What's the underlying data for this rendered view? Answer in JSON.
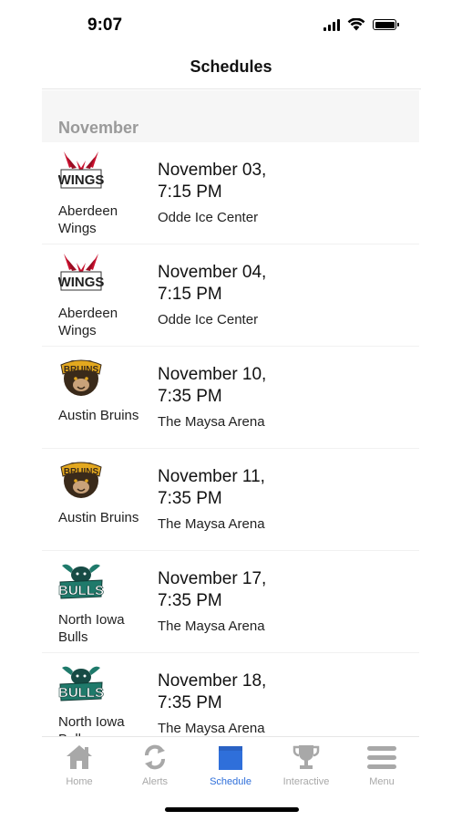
{
  "status_bar": {
    "time": "9:07"
  },
  "header": {
    "title": "Schedules"
  },
  "section": {
    "label": "November"
  },
  "games": [
    {
      "team": "Aberdeen Wings",
      "logo": "wings-logo-icon",
      "date_line1": "November 03,",
      "date_line2": "7:15 PM",
      "venue": "Odde Ice Center"
    },
    {
      "team": "Aberdeen Wings",
      "logo": "wings-logo-icon",
      "date_line1": "November 04,",
      "date_line2": "7:15 PM",
      "venue": "Odde Ice Center"
    },
    {
      "team": "Austin Bruins",
      "logo": "bruins-logo-icon",
      "date_line1": "November 10,",
      "date_line2": "7:35 PM",
      "venue": "The Maysa Arena"
    },
    {
      "team": "Austin Bruins",
      "logo": "bruins-logo-icon",
      "date_line1": "November 11,",
      "date_line2": "7:35 PM",
      "venue": "The Maysa Arena"
    },
    {
      "team": "North Iowa Bulls",
      "logo": "bulls-logo-icon",
      "date_line1": "November 17,",
      "date_line2": "7:35 PM",
      "venue": "The Maysa Arena"
    },
    {
      "team": "North Iowa Bulls",
      "logo": "bulls-logo-icon",
      "date_line1": "November 18,",
      "date_line2": "7:35 PM",
      "venue": "The Maysa Arena"
    }
  ],
  "tabs": [
    {
      "label": "Home",
      "icon": "home-icon",
      "active": false
    },
    {
      "label": "Alerts",
      "icon": "refresh-icon",
      "active": false
    },
    {
      "label": "Schedule",
      "icon": "calendar-icon",
      "active": true
    },
    {
      "label": "Interactive",
      "icon": "trophy-icon",
      "active": false
    },
    {
      "label": "Menu",
      "icon": "menu-icon",
      "active": false
    }
  ],
  "colors": {
    "accent": "#2f6fda",
    "inactive": "#a8a8a8",
    "wings_red": "#c8102e",
    "bruins_gold": "#e3a81f",
    "bulls_green": "#1f7a6b"
  }
}
